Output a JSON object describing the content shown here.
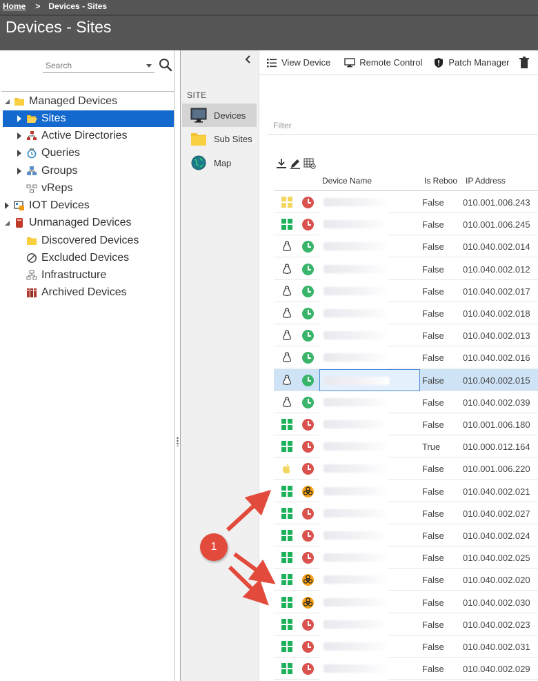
{
  "breadcrumb": {
    "home": "Home",
    "separator": ">",
    "current": "Devices - Sites"
  },
  "page_title": "Devices - Sites",
  "search": {
    "placeholder": "Search"
  },
  "tree": [
    {
      "label": "Managed Devices",
      "expander": "expanded",
      "icon": "folder-icon"
    },
    {
      "label": "Sites",
      "expander": "collapsed",
      "icon": "folder-open-icon",
      "selected": true
    },
    {
      "label": "Active Directories",
      "expander": "collapsed",
      "icon": "network-icon"
    },
    {
      "label": "Queries",
      "expander": "collapsed",
      "icon": "query-icon"
    },
    {
      "label": "Groups",
      "expander": "collapsed",
      "icon": "groups-icon"
    },
    {
      "label": "vReps",
      "expander": "none",
      "icon": "vreps-icon"
    },
    {
      "label": "IOT Devices",
      "expander": "collapsed",
      "icon": "iot-icon"
    },
    {
      "label": "Unmanaged Devices",
      "expander": "expanded",
      "icon": "unmanaged-icon"
    },
    {
      "label": "Discovered Devices",
      "expander": "none",
      "icon": "folder-icon"
    },
    {
      "label": "Excluded Devices",
      "expander": "none",
      "icon": "excluded-icon"
    },
    {
      "label": "Infrastructure",
      "expander": "none",
      "icon": "infrastructure-icon"
    },
    {
      "label": "Archived Devices",
      "expander": "none",
      "icon": "archive-icon"
    }
  ],
  "site_panel": {
    "header": "SITE",
    "items": [
      {
        "label": "Devices",
        "icon": "monitor-icon",
        "active": true
      },
      {
        "label": "Sub Sites",
        "icon": "folder-icon"
      },
      {
        "label": "Map",
        "icon": "globe-icon"
      }
    ]
  },
  "toolbar": {
    "view_device": "View Device",
    "remote_control": "Remote Control",
    "patch_manager": "Patch Manager"
  },
  "filter_label": "Filter",
  "grid": {
    "columns": {
      "device_name": "Device Name",
      "is_reboot": "Is Reboo",
      "ip_address": "IP Address"
    },
    "rows": [
      {
        "os": "windows-yellow",
        "status": "red",
        "reboot": "False",
        "ip": "010.001.006.243"
      },
      {
        "os": "windows",
        "status": "red",
        "reboot": "False",
        "ip": "010.001.006.245"
      },
      {
        "os": "linux",
        "status": "green",
        "reboot": "False",
        "ip": "010.040.002.014"
      },
      {
        "os": "linux",
        "status": "green",
        "reboot": "False",
        "ip": "010.040.002.012"
      },
      {
        "os": "linux",
        "status": "green",
        "reboot": "False",
        "ip": "010.040.002.017"
      },
      {
        "os": "linux",
        "status": "green",
        "reboot": "False",
        "ip": "010.040.002.018"
      },
      {
        "os": "linux",
        "status": "green",
        "reboot": "False",
        "ip": "010.040.002.013"
      },
      {
        "os": "linux",
        "status": "green",
        "reboot": "False",
        "ip": "010.040.002.016"
      },
      {
        "os": "linux",
        "status": "green",
        "reboot": "False",
        "ip": "010.040.002.015",
        "selected": true
      },
      {
        "os": "linux",
        "status": "green",
        "reboot": "False",
        "ip": "010.040.002.039"
      },
      {
        "os": "windows",
        "status": "red",
        "reboot": "False",
        "ip": "010.001.006.180"
      },
      {
        "os": "windows",
        "status": "red",
        "reboot": "True",
        "ip": "010.000.012.164"
      },
      {
        "os": "apple",
        "status": "red",
        "reboot": "False",
        "ip": "010.001.006.220"
      },
      {
        "os": "windows",
        "status": "biohazard",
        "reboot": "False",
        "ip": "010.040.002.021"
      },
      {
        "os": "windows",
        "status": "red",
        "reboot": "False",
        "ip": "010.040.002.027"
      },
      {
        "os": "windows",
        "status": "red",
        "reboot": "False",
        "ip": "010.040.002.024"
      },
      {
        "os": "windows",
        "status": "red",
        "reboot": "False",
        "ip": "010.040.002.025"
      },
      {
        "os": "windows",
        "status": "biohazard",
        "reboot": "False",
        "ip": "010.040.002.020"
      },
      {
        "os": "windows",
        "status": "biohazard",
        "reboot": "False",
        "ip": "010.040.002.030"
      },
      {
        "os": "windows",
        "status": "red",
        "reboot": "False",
        "ip": "010.040.002.023"
      },
      {
        "os": "windows",
        "status": "red",
        "reboot": "False",
        "ip": "010.040.002.031"
      },
      {
        "os": "windows",
        "status": "red",
        "reboot": "False",
        "ip": "010.040.002.029"
      }
    ]
  },
  "callout": {
    "number": "1",
    "color": "#e24a3b"
  },
  "colors": {
    "selection": "#1469cf",
    "header": "#565656",
    "green_status": "#39b56a",
    "red_status": "#d9524d",
    "biohazard": "#f6a21a"
  }
}
